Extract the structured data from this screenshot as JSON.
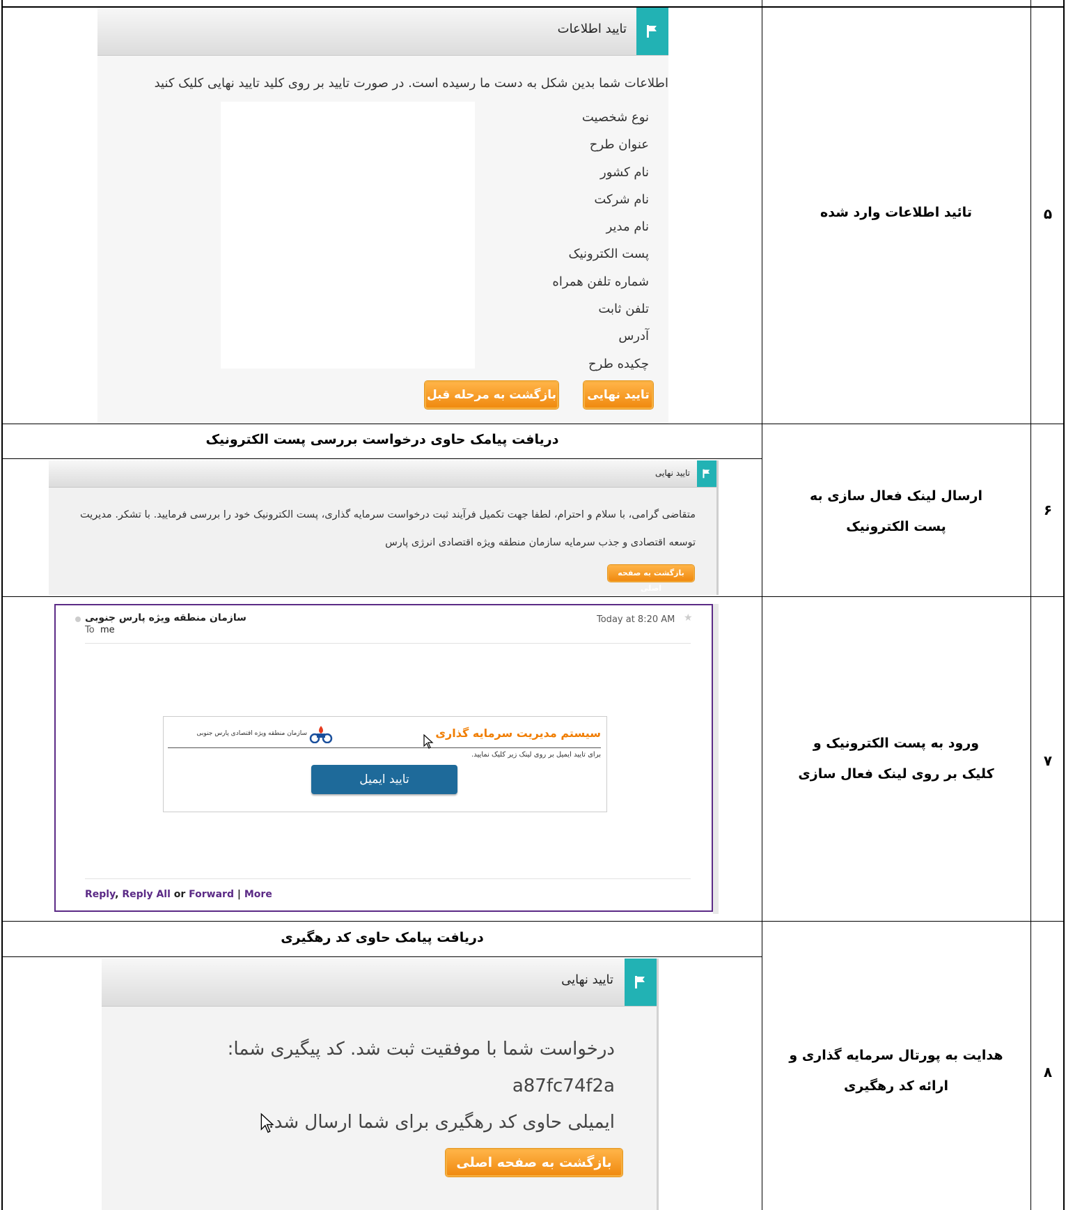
{
  "rows": {
    "r5": {
      "number": "۵",
      "description": "تائید اطلاعات وارد شده",
      "panel": {
        "title": "تایید اطلاعات",
        "intro": "اطلاعات شما بدین شکل به دست ما رسیده است. در صورت تایید بر روی کلید تایید نهایی کلیک کنید",
        "fields": [
          "نوع شخصیت",
          "عنوان طرح",
          "نام کشور",
          "نام شرکت",
          "نام مدیر",
          "پست الکترونیک",
          "شماره تلفن همراه",
          "تلفن ثابت",
          "آدرس",
          "چکیده طرح"
        ],
        "confirm_button": "تایید نهایی",
        "back_button": "بازگشت به مرحله قبل"
      }
    },
    "r6": {
      "number": "۶",
      "description_line1": "ارسال لینک فعال سازی به",
      "description_line2": "پست الکترونیک",
      "sub_header": "دریافت پیامک حاوی درخواست بررسی پست الکترونیک",
      "panel": {
        "title": "تایید نهایی",
        "line1": "متقاضی گرامی، با سلام و احترام، لطفا جهت تکمیل فرآیند ثبت درخواست سرمایه گذاری، پست الکترونیک خود را بررسی فرمایید. با تشکر. مدیریت",
        "line2": "توسعه اقتصادی و جذب سرمایه سازمان منطقه ویژه اقتصادی انرژی پارس",
        "home_button": "بازگشت به صفحه اصلی"
      }
    },
    "r7": {
      "number": "۷",
      "description_line1": "ورود به پست الکترونیک و",
      "description_line2": "کلیک بر روی لینک فعال سازی",
      "email": {
        "sender": "سازمان منطقه ویژه پارس جنوبی",
        "to_label": "To",
        "to_value": "me",
        "time": "Today at 8:20 AM",
        "brand_title": "سیستم مدیریت سرمایه گذاری",
        "org_name": "سازمان منطقه ویژه اقتصادی پارس جنوبی",
        "instruction": "برای تایید ایمیل بر روی لینک زیر کلیک نمایید.",
        "verify_button": "تایید ایمیل",
        "reply": "Reply",
        "comma": ",",
        "reply_all": "Reply All",
        "or": "or",
        "forward": "Forward",
        "pipe": "|",
        "more": "More"
      }
    },
    "r8": {
      "number": "۸",
      "description_line1": "هدایت به پورتال سرمایه گذاری و",
      "description_line2": "ارائه کد رهگیری",
      "sub_header": "دریافت پیامک حاوی کد رهگیری",
      "panel": {
        "title": "تایید نهایی",
        "line1": "درخواست شما با موفقیت ثبت شد. کد پیگیری شما:",
        "code": "a87fc74f2a",
        "line3": "ایمیلی حاوی کد رهگیری برای شما ارسال شد.",
        "home_button": "بازگشت به صفحه اصلی"
      }
    }
  },
  "colors": {
    "teal": "#22b2b4",
    "orange": "#f39415",
    "email_border": "#5b2a86",
    "link": "#5b2a86",
    "verify_button": "#1e6a9a",
    "brand_orange": "#f07d00"
  }
}
